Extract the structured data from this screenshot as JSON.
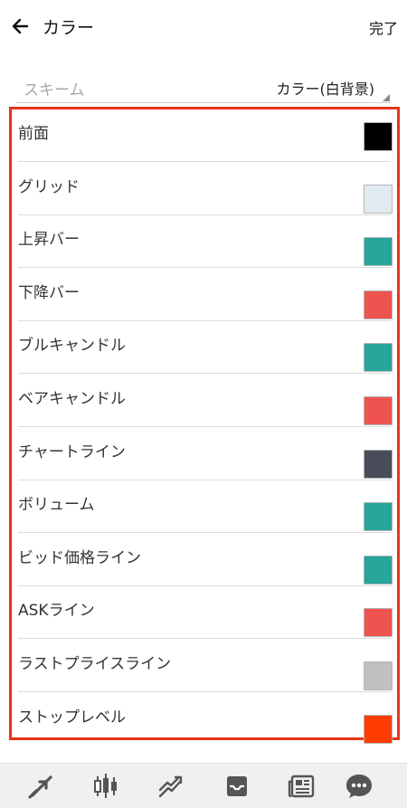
{
  "header": {
    "title": "カラー",
    "done_label": "完了"
  },
  "scheme": {
    "label": "スキーム",
    "value": "カラー(白背景)"
  },
  "colors": [
    {
      "label": "前面",
      "color": "#000000"
    },
    {
      "label": "グリッド",
      "color": "#e1ebf2"
    },
    {
      "label": "上昇バー",
      "color": "#26a69a"
    },
    {
      "label": "下降バー",
      "color": "#ef5350"
    },
    {
      "label": "ブルキャンドル",
      "color": "#26a69a"
    },
    {
      "label": "ベアキャンドル",
      "color": "#ef5350"
    },
    {
      "label": "チャートライン",
      "color": "#4a4d59"
    },
    {
      "label": "ボリューム",
      "color": "#26a69a"
    },
    {
      "label": "ビッド価格ライン",
      "color": "#26a69a"
    },
    {
      "label": "ASKライン",
      "color": "#ef5350"
    },
    {
      "label": "ラストプライスライン",
      "color": "#c0c0c0"
    },
    {
      "label": "ストップレベル",
      "color": "#ff3d00"
    }
  ],
  "bottom_nav": {
    "icons": [
      "trade-arrows-icon",
      "candlestick-icon",
      "trend-chart-icon",
      "inbox-icon",
      "news-icon",
      "chat-icon"
    ]
  },
  "accent_color": "#e8341c"
}
